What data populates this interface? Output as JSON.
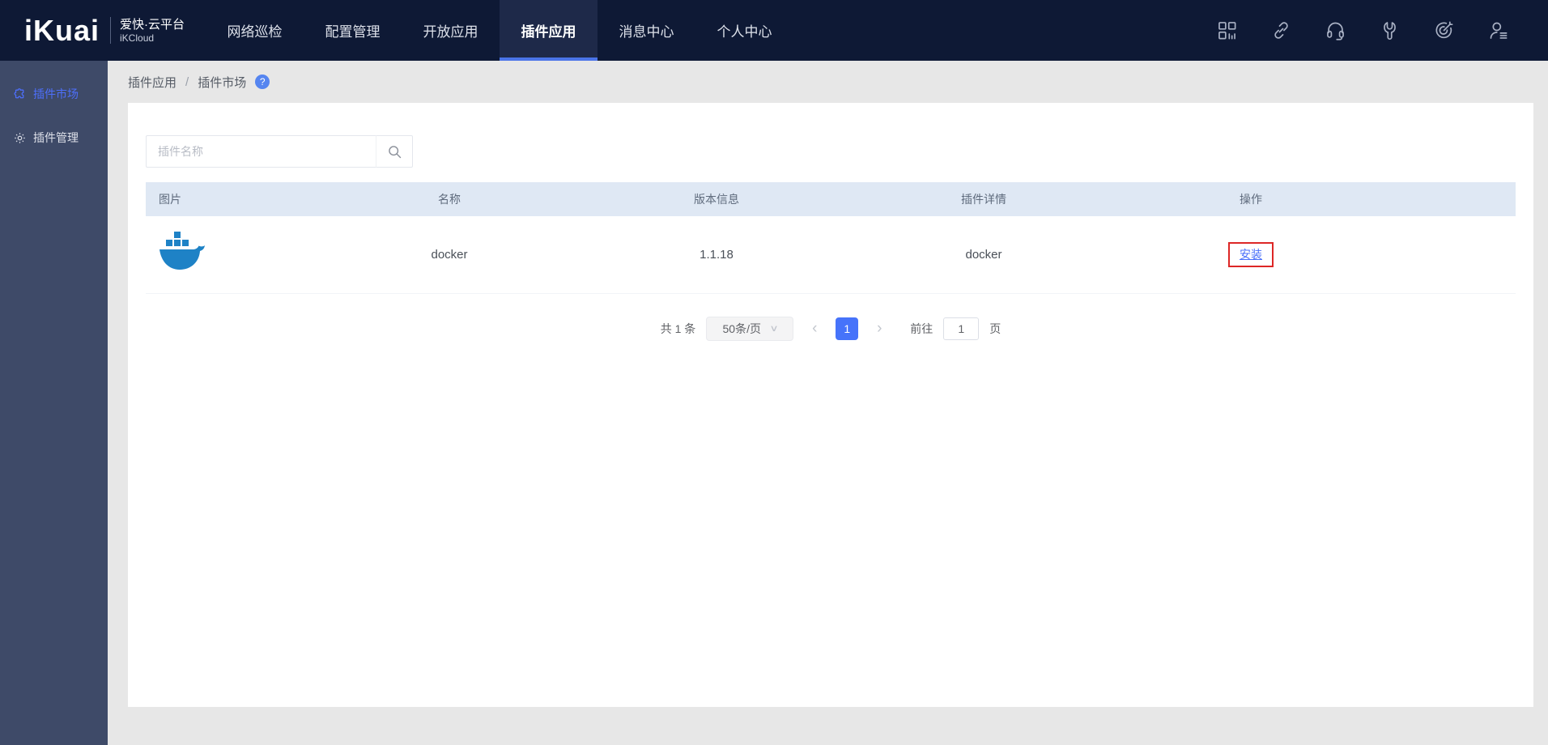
{
  "nav": {
    "logo_text": "iKuai",
    "brand_cn": "爱快·云平台",
    "brand_en": "iKCloud",
    "tabs": [
      {
        "label": "网络巡检",
        "active": false
      },
      {
        "label": "配置管理",
        "active": false
      },
      {
        "label": "开放应用",
        "active": false
      },
      {
        "label": "插件应用",
        "active": true
      },
      {
        "label": "消息中心",
        "active": false
      },
      {
        "label": "个人中心",
        "active": false
      }
    ],
    "icons": [
      "apps-grid-icon",
      "link-icon",
      "headset-icon",
      "wrench-icon",
      "target-arrow-icon",
      "user-menu-icon"
    ]
  },
  "sidebar": {
    "items": [
      {
        "label": "插件市场",
        "icon": "puzzle-icon",
        "active": true
      },
      {
        "label": "插件管理",
        "icon": "gear-icon",
        "active": false
      }
    ]
  },
  "breadcrumb": {
    "items": [
      "插件应用",
      "插件市场"
    ],
    "separator": "/",
    "help_icon": "question-circle-icon",
    "help_glyph": "?"
  },
  "search": {
    "placeholder": "插件名称",
    "icon": "search-icon"
  },
  "table": {
    "headers": [
      "图片",
      "名称",
      "版本信息",
      "插件详情",
      "操作"
    ],
    "rows": [
      {
        "image": "docker-logo",
        "name": "docker",
        "version": "1.1.18",
        "detail": "docker",
        "action": "安装"
      }
    ]
  },
  "pagination": {
    "total_text": "共 1 条",
    "page_size": "50条/页",
    "size_chevron": "∨",
    "prev": "‹",
    "current_page": "1",
    "next": "›",
    "goto_label": "前往",
    "goto_value": "1",
    "page_label": "页"
  },
  "colors": {
    "nav_bg": "#0e1935",
    "nav_active_tab_bg": "#1e2949",
    "nav_active_underline": "#4a74e8",
    "sidebar_bg": "#3e4a68",
    "accent_blue": "#4a6ffa",
    "pager_active_bg": "#4673fa",
    "table_header_bg": "#dfe8f4",
    "docker_blue": "#1e82c6",
    "annotation_red": "#dd2726",
    "help_badge_bg": "#5585f0"
  }
}
